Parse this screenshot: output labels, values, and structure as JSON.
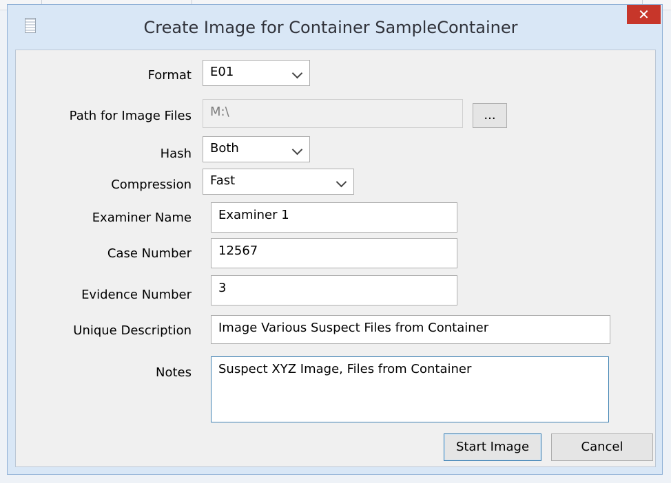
{
  "dialog": {
    "title": "Create Image for Container SampleContainer",
    "close_glyph": "✕"
  },
  "form": {
    "format": {
      "label": "Format",
      "value": "E01"
    },
    "path": {
      "label": "Path for Image Files",
      "value": "M:\\",
      "browse_label": "..."
    },
    "hash": {
      "label": "Hash",
      "value": "Both"
    },
    "compression": {
      "label": "Compression",
      "value": "Fast"
    },
    "examiner": {
      "label": "Examiner Name",
      "value": "Examiner 1"
    },
    "case_number": {
      "label": "Case Number",
      "value": "12567"
    },
    "evidence": {
      "label": "Evidence Number",
      "value": "3"
    },
    "description": {
      "label": "Unique Description",
      "value": "Image Various Suspect Files from Container"
    },
    "notes": {
      "label": "Notes",
      "value": "Suspect XYZ Image, Files from Container"
    }
  },
  "buttons": {
    "start": "Start Image",
    "cancel": "Cancel"
  },
  "icons": {
    "app": "document-icon",
    "close": "close-icon",
    "dropdown": "chevron-down-icon"
  },
  "colors": {
    "frame": "#d9e7f6",
    "close_button": "#c7362a",
    "focus_border": "#3c7fb1"
  }
}
